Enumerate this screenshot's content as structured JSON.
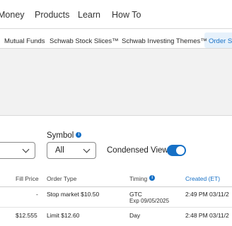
{
  "topnav": {
    "items": [
      "Money",
      "Products",
      "Learn",
      "How To"
    ]
  },
  "subnav": {
    "items": [
      "Mutual Funds",
      "Schwab Stock Slices™",
      "Schwab Investing Themes™",
      "Order St"
    ]
  },
  "filters": {
    "symbol_label": "Symbol",
    "symbol_value": "All",
    "condensed_label": "Condensed View",
    "condensed_on": true
  },
  "table": {
    "headers": {
      "fill_price": "Fill Price",
      "order_type": "Order Type",
      "timing": "Timing",
      "created": "Created (ET)"
    },
    "rows": [
      {
        "fill_price": "-",
        "order_type": "Stop market $10.50",
        "timing": "GTC",
        "timing_sub": "Exp 09/05/2025",
        "created": "2:49 PM 03/11/2"
      },
      {
        "fill_price": "$12.555",
        "order_type": "Limit $12.60",
        "timing": "Day",
        "timing_sub": "",
        "created": "2:48 PM 03/11/2"
      }
    ]
  },
  "colors": {
    "accent": "#1670c6",
    "banner": "#f2f2f2"
  }
}
